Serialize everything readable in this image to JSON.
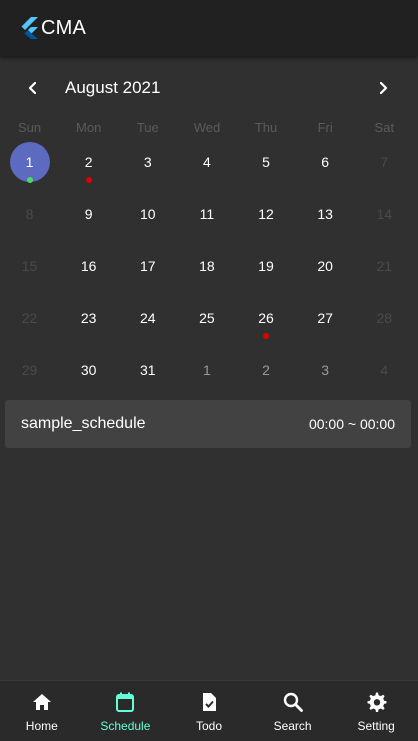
{
  "app": {
    "title": "CMA"
  },
  "calendar": {
    "month_label": "August 2021",
    "weekdays": [
      "Sun",
      "Mon",
      "Tue",
      "Wed",
      "Thu",
      "Fri",
      "Sat"
    ],
    "weeks": [
      [
        {
          "label": "1",
          "outside": false,
          "selected": true,
          "marker": "#4cd964"
        },
        {
          "label": "2",
          "outside": false,
          "selected": false,
          "marker": "#e00000"
        },
        {
          "label": "3",
          "outside": false,
          "selected": false,
          "marker": null
        },
        {
          "label": "4",
          "outside": false,
          "selected": false,
          "marker": null
        },
        {
          "label": "5",
          "outside": false,
          "selected": false,
          "marker": null
        },
        {
          "label": "6",
          "outside": false,
          "selected": false,
          "marker": null
        },
        {
          "label": "7",
          "outside": false,
          "selected": false,
          "marker": null
        }
      ],
      [
        {
          "label": "8",
          "outside": false,
          "selected": false,
          "marker": null
        },
        {
          "label": "9",
          "outside": false,
          "selected": false,
          "marker": null
        },
        {
          "label": "10",
          "outside": false,
          "selected": false,
          "marker": null
        },
        {
          "label": "11",
          "outside": false,
          "selected": false,
          "marker": null
        },
        {
          "label": "12",
          "outside": false,
          "selected": false,
          "marker": null
        },
        {
          "label": "13",
          "outside": false,
          "selected": false,
          "marker": null
        },
        {
          "label": "14",
          "outside": false,
          "selected": false,
          "marker": null
        }
      ],
      [
        {
          "label": "15",
          "outside": false,
          "selected": false,
          "marker": null
        },
        {
          "label": "16",
          "outside": false,
          "selected": false,
          "marker": null
        },
        {
          "label": "17",
          "outside": false,
          "selected": false,
          "marker": null
        },
        {
          "label": "18",
          "outside": false,
          "selected": false,
          "marker": null
        },
        {
          "label": "19",
          "outside": false,
          "selected": false,
          "marker": null
        },
        {
          "label": "20",
          "outside": false,
          "selected": false,
          "marker": null
        },
        {
          "label": "21",
          "outside": false,
          "selected": false,
          "marker": null
        }
      ],
      [
        {
          "label": "22",
          "outside": false,
          "selected": false,
          "marker": null
        },
        {
          "label": "23",
          "outside": false,
          "selected": false,
          "marker": null
        },
        {
          "label": "24",
          "outside": false,
          "selected": false,
          "marker": null
        },
        {
          "label": "25",
          "outside": false,
          "selected": false,
          "marker": null
        },
        {
          "label": "26",
          "outside": false,
          "selected": false,
          "marker": "#e00000"
        },
        {
          "label": "27",
          "outside": false,
          "selected": false,
          "marker": null
        },
        {
          "label": "28",
          "outside": false,
          "selected": false,
          "marker": null
        }
      ],
      [
        {
          "label": "29",
          "outside": false,
          "selected": false,
          "marker": null
        },
        {
          "label": "30",
          "outside": false,
          "selected": false,
          "marker": null
        },
        {
          "label": "31",
          "outside": false,
          "selected": false,
          "marker": null
        },
        {
          "label": "1",
          "outside": true,
          "selected": false,
          "marker": null
        },
        {
          "label": "2",
          "outside": true,
          "selected": false,
          "marker": null
        },
        {
          "label": "3",
          "outside": true,
          "selected": false,
          "marker": null
        },
        {
          "label": "4",
          "outside": true,
          "selected": false,
          "marker": null
        }
      ]
    ]
  },
  "events": [
    {
      "title": "sample_schedule",
      "time": "00:00 ~ 00:00"
    }
  ],
  "bottom_nav": {
    "items": [
      {
        "label": "Home",
        "icon": "home-icon",
        "active": false
      },
      {
        "label": "Schedule",
        "icon": "calendar-icon",
        "active": true
      },
      {
        "label": "Todo",
        "icon": "todo-icon",
        "active": false
      },
      {
        "label": "Search",
        "icon": "search-icon",
        "active": false
      },
      {
        "label": "Setting",
        "icon": "gear-icon",
        "active": false
      }
    ]
  },
  "colors": {
    "accent": "#64ffda",
    "selected_day": "#5c6bc0",
    "event_marker": "#e00000",
    "today_marker": "#4cd964",
    "inactive_nav": "#ffffff"
  }
}
